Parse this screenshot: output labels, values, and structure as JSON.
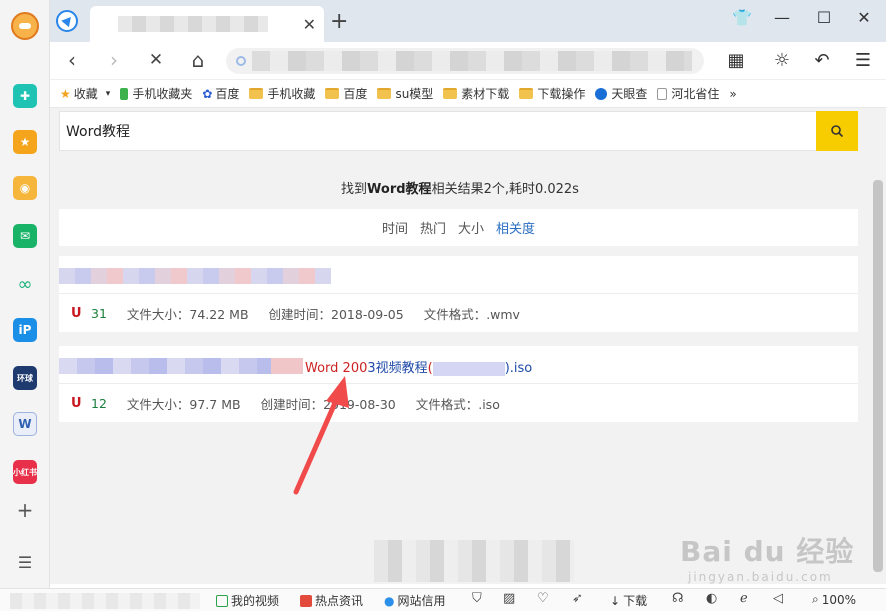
{
  "tabbar": {
    "close_glyph": "✕",
    "new_tab_glyph": "+",
    "controls": [
      "skin-icon",
      "minimize-icon",
      "maximize-icon",
      "close-icon"
    ]
  },
  "toolbar": {
    "back": "‹",
    "forward": "›",
    "stop": "✕",
    "home": "⌂"
  },
  "bookmarks": [
    {
      "label": "收藏",
      "icon": "star-icon"
    },
    {
      "label": "手机收藏夹",
      "icon": "phone-icon"
    },
    {
      "label": "百度",
      "icon": "baidu-paw-icon"
    },
    {
      "label": "手机收藏",
      "icon": "folder-icon"
    },
    {
      "label": "百度",
      "icon": "folder-icon"
    },
    {
      "label": "su模型",
      "icon": "folder-icon"
    },
    {
      "label": "素材下载",
      "icon": "folder-icon"
    },
    {
      "label": "下载操作",
      "icon": "folder-icon"
    },
    {
      "label": "天眼查",
      "icon": "tianyancha-icon"
    },
    {
      "label": "河北省住",
      "icon": "page-icon"
    }
  ],
  "bookmarks_more": "»",
  "search": {
    "value": "Word教程"
  },
  "summary": {
    "prefix": "找到",
    "keyword": "Word教程",
    "suffix": "相关结果2个,耗时0.022s"
  },
  "sort": {
    "options": [
      "时间",
      "热门",
      "大小",
      "相关度"
    ],
    "active": "相关度"
  },
  "results": [
    {
      "title_visible": "",
      "magnet": "U",
      "count": "31",
      "size": "文件大小：74.22 MB",
      "created": "创建时间：2018-09-05",
      "format": "文件格式：.wmv"
    },
    {
      "title_red": "Word 200",
      "title_blue": "3视频教程",
      "title_paren_open": "(",
      "title_end": ").iso",
      "magnet": "U",
      "count": "12",
      "size": "文件大小：97.7 MB",
      "created": "创建时间：2019-08-30",
      "format": "文件格式：.iso"
    }
  ],
  "watermark": {
    "main": "Bai du 经验",
    "sub": "jingyan.baidu.com"
  },
  "statusbar": {
    "video": "我的视频",
    "news": "热点资讯",
    "credit": "网站信用",
    "download": "下载",
    "zoom": "100%"
  },
  "colors": {
    "search_button": "#f7cd00",
    "active_sort": "#2b6fc2",
    "magnet": "#c8171e",
    "count": "#1a7f3c",
    "arrow": "#f04a4a"
  }
}
